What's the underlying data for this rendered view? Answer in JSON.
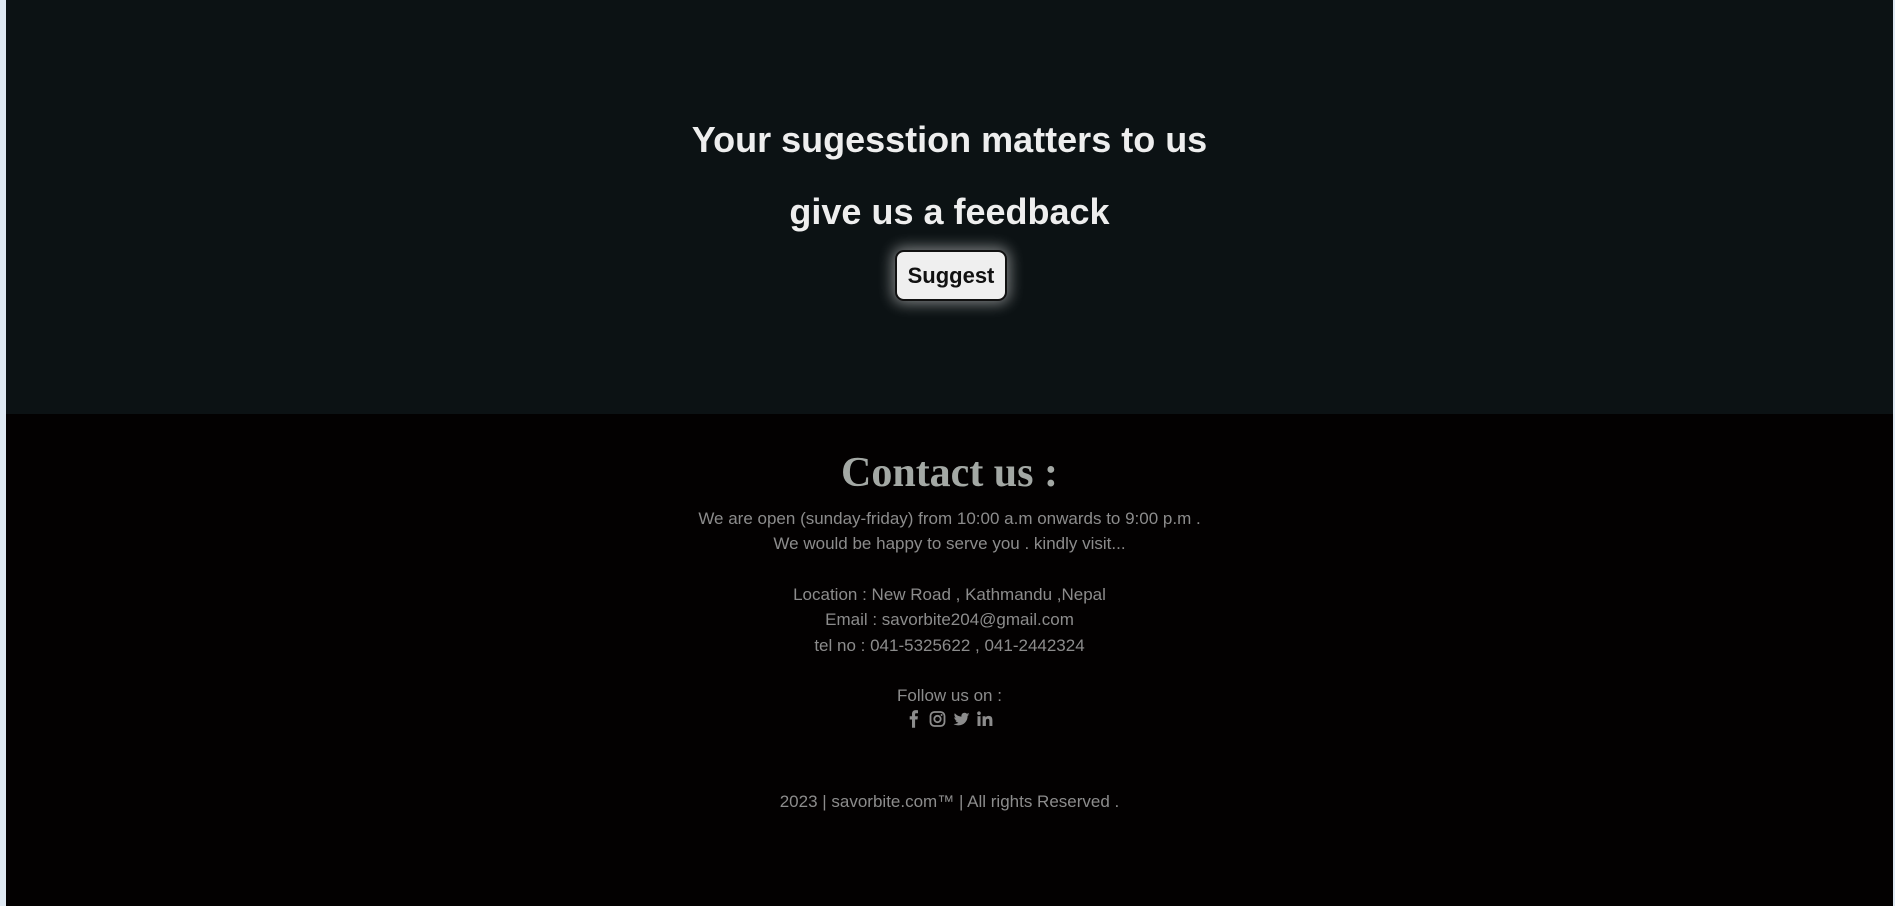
{
  "feedback": {
    "line1": "Your sugesstion matters to us",
    "line2": "give us a feedback",
    "button_label": "Suggest"
  },
  "footer": {
    "title": "Contact us :",
    "hours": "We are open (sunday-friday) from 10:00 a.m onwards to 9:00 p.m .",
    "invite": "We would be happy to serve you . kindly visit...",
    "location": "Location : New Road , Kathmandu ,Nepal",
    "email": "Email : savorbite204@gmail.com",
    "tel": "tel no : 041-5325622 , 041-2442324",
    "follow": "Follow us on :",
    "social_icons": [
      "facebook-icon",
      "instagram-icon",
      "twitter-icon",
      "linkedin-icon"
    ],
    "copyright": "2023 | savorbite.com™ | All rights Reserved ."
  },
  "colors": {
    "feedback_bg": "#0c1214",
    "footer_bg": "#030101",
    "heading_text": "#eeeeee",
    "footer_text": "#8c8c8c",
    "contact_title": "#a3a8a4",
    "button_bg": "#efefef"
  }
}
